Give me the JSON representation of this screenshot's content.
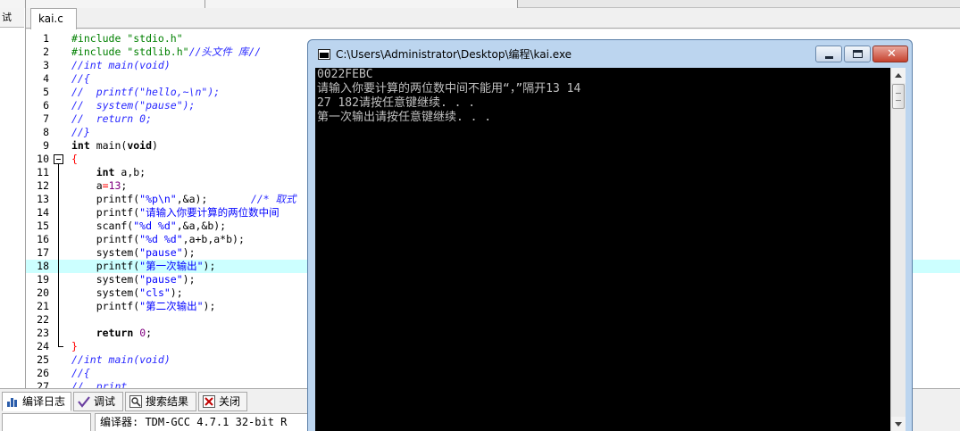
{
  "left_panel": {
    "tab_label": "试"
  },
  "editor": {
    "file_tab": "kai.c",
    "lines": [
      {
        "n": "1",
        "tokens": [
          {
            "c": "pp",
            "t": "#include \"stdio.h\""
          }
        ]
      },
      {
        "n": "2",
        "tokens": [
          {
            "c": "pp",
            "t": "#include \"stdlib.h\""
          },
          {
            "c": "cmt",
            "t": "//头文件 库//"
          }
        ]
      },
      {
        "n": "3",
        "tokens": [
          {
            "c": "cmt",
            "t": "//int main(void)"
          }
        ]
      },
      {
        "n": "4",
        "tokens": [
          {
            "c": "cmt",
            "t": "//{"
          }
        ]
      },
      {
        "n": "5",
        "tokens": [
          {
            "c": "cmt",
            "t": "//  printf(\"hello,~\\n\");"
          }
        ]
      },
      {
        "n": "6",
        "tokens": [
          {
            "c": "cmt",
            "t": "//  system(\"pause\");"
          }
        ]
      },
      {
        "n": "7",
        "tokens": [
          {
            "c": "cmt",
            "t": "//  return 0;"
          }
        ]
      },
      {
        "n": "8",
        "tokens": [
          {
            "c": "cmt",
            "t": "//}"
          }
        ]
      },
      {
        "n": "9",
        "tokens": [
          {
            "c": "kw",
            "t": "int"
          },
          {
            "c": "pl",
            "t": " main("
          },
          {
            "c": "kw",
            "t": "void"
          },
          {
            "c": "pl",
            "t": ")"
          }
        ]
      },
      {
        "n": "10",
        "tokens": [
          {
            "c": "op",
            "t": "{"
          }
        ]
      },
      {
        "n": "11",
        "tokens": [
          {
            "c": "pl",
            "t": "    "
          },
          {
            "c": "kw",
            "t": "int"
          },
          {
            "c": "pl",
            "t": " a,b;"
          }
        ]
      },
      {
        "n": "12",
        "tokens": [
          {
            "c": "pl",
            "t": "    a"
          },
          {
            "c": "op",
            "t": "="
          },
          {
            "c": "num",
            "t": "13"
          },
          {
            "c": "pl",
            "t": ";"
          }
        ]
      },
      {
        "n": "13",
        "tokens": [
          {
            "c": "pl",
            "t": "    printf("
          },
          {
            "c": "str",
            "t": "\"%p\\n\""
          },
          {
            "c": "pl",
            "t": ",&a);       "
          },
          {
            "c": "cmt",
            "t": "//* 取式"
          }
        ]
      },
      {
        "n": "14",
        "tokens": [
          {
            "c": "pl",
            "t": "    printf("
          },
          {
            "c": "str",
            "t": "\"请输入你要计算的两位数中间"
          }
        ]
      },
      {
        "n": "15",
        "tokens": [
          {
            "c": "pl",
            "t": "    scanf("
          },
          {
            "c": "str",
            "t": "\"%d %d\""
          },
          {
            "c": "pl",
            "t": ",&a,&b);"
          }
        ]
      },
      {
        "n": "16",
        "tokens": [
          {
            "c": "pl",
            "t": "    printf("
          },
          {
            "c": "str",
            "t": "\"%d %d\""
          },
          {
            "c": "pl",
            "t": ",a+b,a*b);"
          }
        ]
      },
      {
        "n": "17",
        "tokens": [
          {
            "c": "pl",
            "t": "    system("
          },
          {
            "c": "str",
            "t": "\"pause\""
          },
          {
            "c": "pl",
            "t": ");"
          }
        ]
      },
      {
        "n": "18",
        "tokens": [
          {
            "c": "pl",
            "t": "    printf("
          },
          {
            "c": "str",
            "t": "\"第一次输出\""
          },
          {
            "c": "pl",
            "t": ");"
          }
        ]
      },
      {
        "n": "19",
        "tokens": [
          {
            "c": "pl",
            "t": "    system("
          },
          {
            "c": "str",
            "t": "\"pause\""
          },
          {
            "c": "pl",
            "t": ");"
          }
        ]
      },
      {
        "n": "20",
        "tokens": [
          {
            "c": "pl",
            "t": "    system("
          },
          {
            "c": "str",
            "t": "\"cls\""
          },
          {
            "c": "pl",
            "t": ");"
          }
        ]
      },
      {
        "n": "21",
        "tokens": [
          {
            "c": "pl",
            "t": "    printf("
          },
          {
            "c": "str",
            "t": "\"第二次输出\""
          },
          {
            "c": "pl",
            "t": ");"
          }
        ]
      },
      {
        "n": "22",
        "tokens": []
      },
      {
        "n": "23",
        "tokens": [
          {
            "c": "pl",
            "t": "    "
          },
          {
            "c": "kw",
            "t": "return"
          },
          {
            "c": "pl",
            "t": " "
          },
          {
            "c": "num",
            "t": "0"
          },
          {
            "c": "pl",
            "t": ";"
          }
        ]
      },
      {
        "n": "24",
        "tokens": [
          {
            "c": "op",
            "t": "}"
          }
        ]
      },
      {
        "n": "25",
        "tokens": [
          {
            "c": "cmt",
            "t": "//int main(void)"
          }
        ]
      },
      {
        "n": "26",
        "tokens": [
          {
            "c": "cmt",
            "t": "//{"
          }
        ]
      },
      {
        "n": "27",
        "tokens": [
          {
            "c": "cmt",
            "t": "//  print"
          }
        ]
      }
    ],
    "highlighted_line": "18"
  },
  "console": {
    "title": "C:\\Users\\Administrator\\Desktop\\编程\\kai.exe",
    "output": [
      "0022FEBC",
      "请输入你要计算的两位数中间不能用“，”隔开13 14",
      "27 182请按任意键继续. . .",
      "第一次输出请按任意键继续. . ."
    ]
  },
  "bottom": {
    "tabs": [
      "编译日志",
      "调试",
      "搜索结果",
      "关闭"
    ],
    "compiler_text": "编译器: TDM-GCC 4.7.1 32-bit R"
  },
  "colors": {
    "highlight_line": "#ccffff",
    "console_bg": "#000000",
    "console_text": "#c0c0c0",
    "preprocessor": "#008000",
    "string": "#0000ff",
    "operator": "#ff0000"
  }
}
